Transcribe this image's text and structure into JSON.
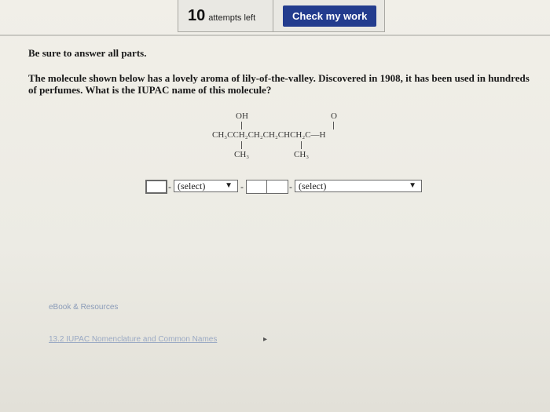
{
  "header": {
    "attempts_count": "10",
    "attempts_label": "attempts left",
    "check_button": "Check my work"
  },
  "instructions": "Be sure to answer all parts.",
  "question": "The molecule shown below has a lovely aroma of lily-of-the-valley. Discovered in 1908, it has been used in hundreds of perfumes. What is the IUPAC name of this molecule?",
  "molecule": {
    "top_oh": "OH",
    "top_o": "O",
    "main_chain": "CH₃CCH₂CH₂CH₂CHCH₂C—H",
    "bottom_ch3_a": "CH₃",
    "bottom_ch3_b": "CH₃"
  },
  "answer": {
    "select_1": "(select)",
    "select_2": "(select)",
    "dash": "-"
  },
  "footer": {
    "ebook": "eBook & Resources",
    "link": "13.2 IUPAC Nomenclature and Common Names"
  }
}
